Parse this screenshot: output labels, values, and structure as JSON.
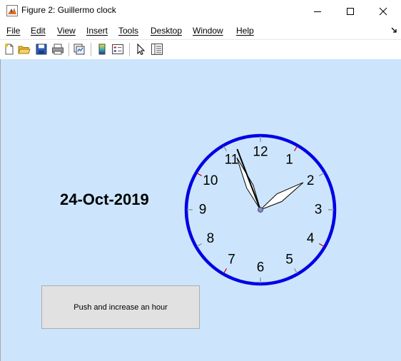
{
  "window": {
    "title": "Figure 2: Guillermo clock",
    "minimize_icon": "minimize-icon",
    "maximize_icon": "maximize-icon",
    "close_icon": "close-icon"
  },
  "menu": {
    "items": [
      {
        "label": "File"
      },
      {
        "label": "Edit"
      },
      {
        "label": "View"
      },
      {
        "label": "Insert"
      },
      {
        "label": "Tools"
      },
      {
        "label": "Desktop"
      },
      {
        "label": "Window"
      },
      {
        "label": "Help"
      }
    ],
    "dock_icon": "undock-arrow-icon"
  },
  "toolbar": {
    "icons": [
      "new-figure-icon",
      "open-file-icon",
      "save-icon",
      "print-icon",
      "link-plot-icon",
      "insert-colorbar-icon",
      "insert-legend-icon",
      "edit-plot-pointer-icon",
      "property-inspector-icon"
    ]
  },
  "figure": {
    "background": "#cce5fd",
    "date": "24-Oct-2019",
    "button_label": "Push and increase an hour"
  },
  "clock": {
    "numerals": [
      "12",
      "1",
      "2",
      "3",
      "4",
      "5",
      "6",
      "7",
      "8",
      "9",
      "10",
      "11"
    ],
    "hour": 1,
    "minute": 55,
    "second": 56.5,
    "colors": {
      "rim": "#0000e6",
      "hands_fill": "#ffffff",
      "hands_stroke": "#000000",
      "second_hand": "#000000",
      "center": "#8888cc",
      "red_tick": "#cc0000",
      "grey_tick": "#888888"
    }
  }
}
